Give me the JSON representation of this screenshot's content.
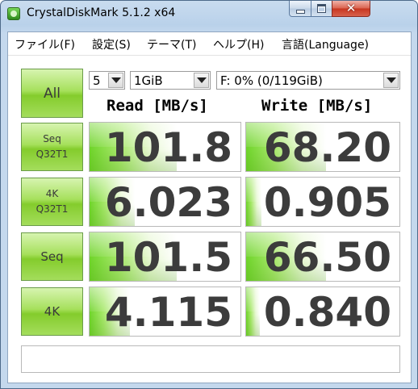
{
  "window": {
    "title": "CrystalDiskMark 5.1.2 x64",
    "controls": [
      "minimize",
      "maximize",
      "close"
    ]
  },
  "menu": {
    "items": [
      {
        "label": "ファイル(F)"
      },
      {
        "label": "設定(S)"
      },
      {
        "label": "テーマ(T)"
      },
      {
        "label": "ヘルプ(H)"
      },
      {
        "label": "言語(Language)"
      }
    ]
  },
  "controls": {
    "all_label": "All",
    "count_value": "5",
    "size_value": "1GiB",
    "drive_value": "F: 0% (0/119GiB)"
  },
  "headers": {
    "read": "Read [MB/s]",
    "write": "Write [MB/s]"
  },
  "rows": [
    {
      "label_line1": "Seq",
      "label_line2": "Q32T1",
      "read": "101.8",
      "write": "68.20",
      "read_level": 0.58,
      "write_level": 0.52
    },
    {
      "label_line1": "4K",
      "label_line2": "Q32T1",
      "read": "6.023",
      "write": "0.905",
      "read_level": 0.3,
      "write_level": 0.1
    },
    {
      "label_line1": "Seq",
      "label_line2": "",
      "read": "101.5",
      "write": "66.50",
      "read_level": 0.58,
      "write_level": 0.52
    },
    {
      "label_line1": "4K",
      "label_line2": "",
      "read": "4.115",
      "write": "0.840",
      "read_level": 0.27,
      "write_level": 0.09
    }
  ],
  "comment": "",
  "colors": {
    "accent_green": "#84cc2c",
    "value_text": "#3c3c3c",
    "window_frame": "#b9d1ea",
    "close_button": "#c7351f"
  }
}
